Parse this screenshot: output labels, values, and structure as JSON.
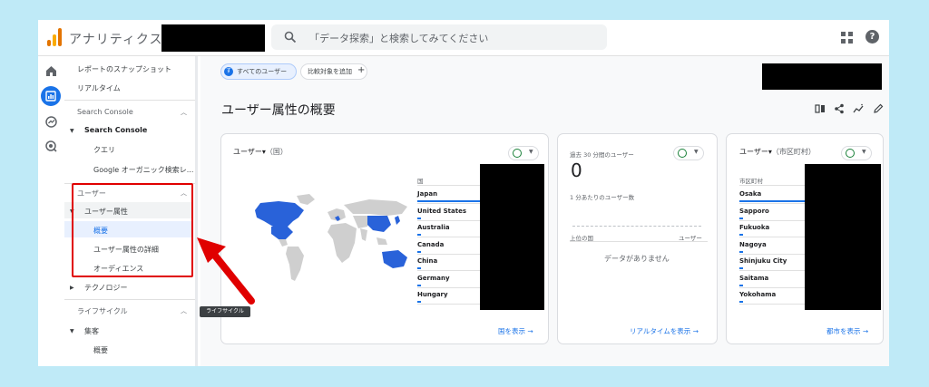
{
  "header": {
    "app_name": "アナリティクス",
    "search_placeholder": "「データ探索」と検索してみてください",
    "help_label": "?"
  },
  "sidebar": {
    "items": [
      {
        "label": "レポートのスナップショット"
      },
      {
        "label": "リアルタイム"
      },
      {
        "label": "Search Console"
      },
      {
        "label": "Search Console"
      },
      {
        "label": "クエリ"
      },
      {
        "label": "Google オーガニック検索レ..."
      },
      {
        "label": "ユーザー"
      },
      {
        "label": "ユーザー属性"
      },
      {
        "label": "概要"
      },
      {
        "label": "ユーザー属性の詳細"
      },
      {
        "label": "オーディエンス"
      },
      {
        "label": "テクノロジー"
      },
      {
        "label": "ライフサイクル"
      },
      {
        "label": "集客"
      },
      {
        "label": "概要"
      }
    ],
    "tooltip": "ライフサイクル"
  },
  "toolbar": {
    "segment_badge": "す",
    "segment_label": "すべてのユーザー",
    "compare_label": "比較対象を追加",
    "compare_plus": "+"
  },
  "page": {
    "title": "ユーザー属性の概要"
  },
  "cards": {
    "country": {
      "title": "ユーザー▾",
      "subtitle": "（国）",
      "column": "国",
      "rows": [
        "Japan",
        "United States",
        "Australia",
        "Canada",
        "China",
        "Germany",
        "Hungary"
      ],
      "link": "国を表示"
    },
    "realtime": {
      "title": "過去 30 分間のユーザー",
      "value": "0",
      "per_minute": "1 分あたりのユーザー数",
      "col_left": "上位の国",
      "col_right": "ユーザー",
      "empty": "データがありません",
      "link": "リアルタイムを表示"
    },
    "city": {
      "title": "ユーザー▾",
      "subtitle": "（市区町村）",
      "column": "市区町村",
      "rows": [
        "Osaka",
        "Sapporo",
        "Fukuoka",
        "Nagoya",
        "Shinjuku City",
        "Saitama",
        "Yokohama"
      ],
      "link": "都市を表示"
    }
  },
  "colors": {
    "accent": "#1a73e8",
    "annotation": "#e00000",
    "background": "#bfeaf7"
  }
}
